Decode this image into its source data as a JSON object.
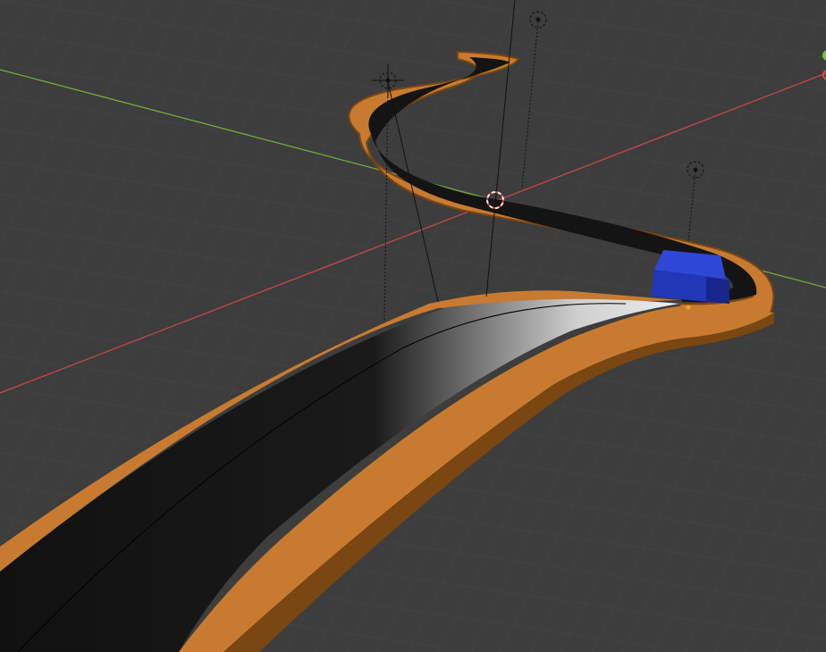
{
  "viewport": {
    "background": "#3d3d3d",
    "grid_minor": "#454545",
    "grid_major": "#4d4d4d",
    "x_axis_color": "#c6454f",
    "y_axis_color": "#79a83a"
  },
  "scene": {
    "road_surface_color": "#141414",
    "rail_color": "#c87b30",
    "rail_shade_color": "#7a4612",
    "vehicle_color": "#2236b8",
    "objects": [
      "light-1",
      "light-2",
      "light-3",
      "3d-cursor",
      "vehicle"
    ]
  }
}
